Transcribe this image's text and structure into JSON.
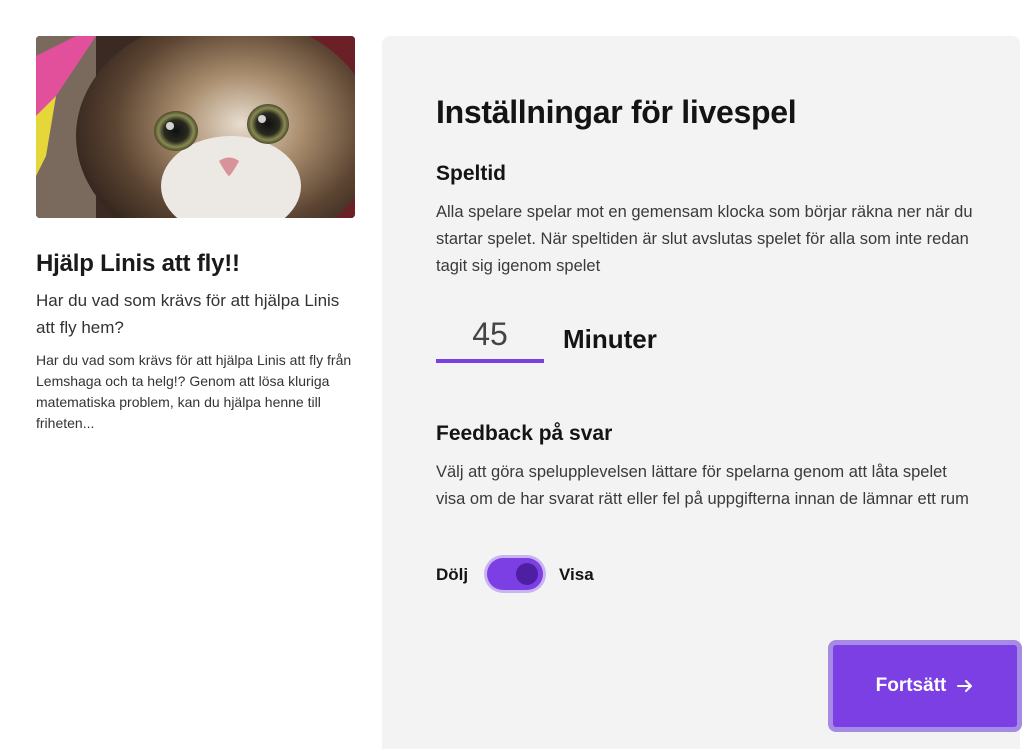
{
  "game": {
    "title": "Hjälp Linis att fly!!",
    "lead": "Har du vad som krävs för att hjälpa Linis att fly hem?",
    "description": "Har du vad som krävs för att hjälpa Linis att fly från Lemshaga och ta helg!? Genom att lösa kluriga matematiska problem, kan du hjälpa henne till friheten..."
  },
  "settings": {
    "title": "Inställningar för livespel",
    "playtime": {
      "heading": "Speltid",
      "text": "Alla spelare spelar mot en gemensam klocka som börjar räkna ner när du startar spelet. När speltiden är slut avslutas spelet för alla som inte redan tagit sig igenom spelet",
      "value": "45",
      "unit": "Minuter"
    },
    "feedback": {
      "heading": "Feedback på svar",
      "text": "Välj att göra spelupplevelsen lättare för spelarna genom att låta spelet visa om de har svarat rätt eller fel på uppgifterna innan de lämnar ett rum",
      "off_label": "Dölj",
      "on_label": "Visa",
      "enabled": true
    },
    "continue_label": "Fortsätt",
    "accent_color": "#7b3fe4"
  }
}
